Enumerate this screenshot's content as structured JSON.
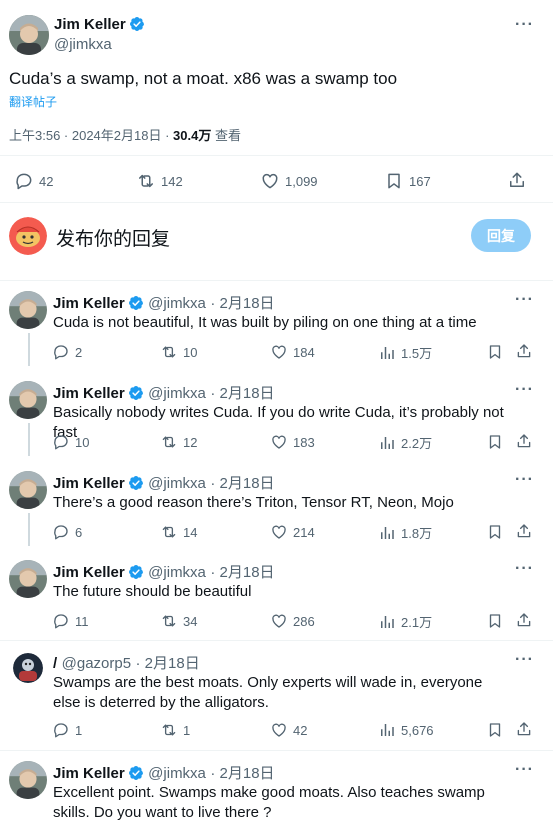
{
  "main_tweet": {
    "author_name": "Jim Keller",
    "author_handle": "@jimkxa",
    "text": "Cuda’s a swamp, not a moat. x86 was a swamp too",
    "translate_label": "翻译帖子",
    "timestamp": "上午3:56 · 2024年2月18日 · ",
    "views_count": "30.4万",
    "views_label": " 查看",
    "replies": "42",
    "retweets": "142",
    "likes": "1,099",
    "bookmarks": "167"
  },
  "compose": {
    "placeholder": "发布你的回复",
    "reply_button": "回复"
  },
  "replies": [
    {
      "name": "Jim Keller",
      "handle": "@jimkxa",
      "date": "· 2月18日",
      "text": "Cuda is not beautiful, It was built by piling on one thing at a time",
      "replies": "2",
      "retweets": "10",
      "likes": "184",
      "views": "1.5万"
    },
    {
      "name": "Jim Keller",
      "handle": "@jimkxa",
      "date": "· 2月18日",
      "text": "Basically nobody writes Cuda. If you do write Cuda, it’s probably not fast",
      "replies": "10",
      "retweets": "12",
      "likes": "183",
      "views": "2.2万"
    },
    {
      "name": "Jim Keller",
      "handle": "@jimkxa",
      "date": "· 2月18日",
      "text": "There’s a good reason there’s Triton, Tensor RT, Neon, Mojo",
      "replies": "6",
      "retweets": "14",
      "likes": "214",
      "views": "1.8万"
    },
    {
      "name": "Jim Keller",
      "handle": "@jimkxa",
      "date": "· 2月18日",
      "text": "The future should be beautiful",
      "replies": "11",
      "retweets": "34",
      "likes": "286",
      "views": "2.1万"
    },
    {
      "name": "/",
      "handle": "@gazorp5",
      "date": "· 2月18日",
      "text": "Swamps are the best moats. Only experts will wade in, everyone else is deterred by the alligators.",
      "replies": "1",
      "retweets": "1",
      "likes": "42",
      "views": "5,676"
    },
    {
      "name": "Jim Keller",
      "handle": "@jimkxa",
      "date": "· 2月18日",
      "text": "Excellent point. Swamps make good moats. Also teaches swamp skills. Do you want to live there ?",
      "replies": "",
      "retweets": "",
      "likes": "",
      "views": ""
    }
  ],
  "colors": {
    "accent": "#1d9bf0",
    "verified": "#1d9bf0",
    "reply_button_bg": "#8ecdf8"
  },
  "icons": [
    "verified-icon",
    "more-icon",
    "reply-icon",
    "retweet-icon",
    "like-icon",
    "views-icon",
    "bookmark-icon",
    "share-icon"
  ]
}
